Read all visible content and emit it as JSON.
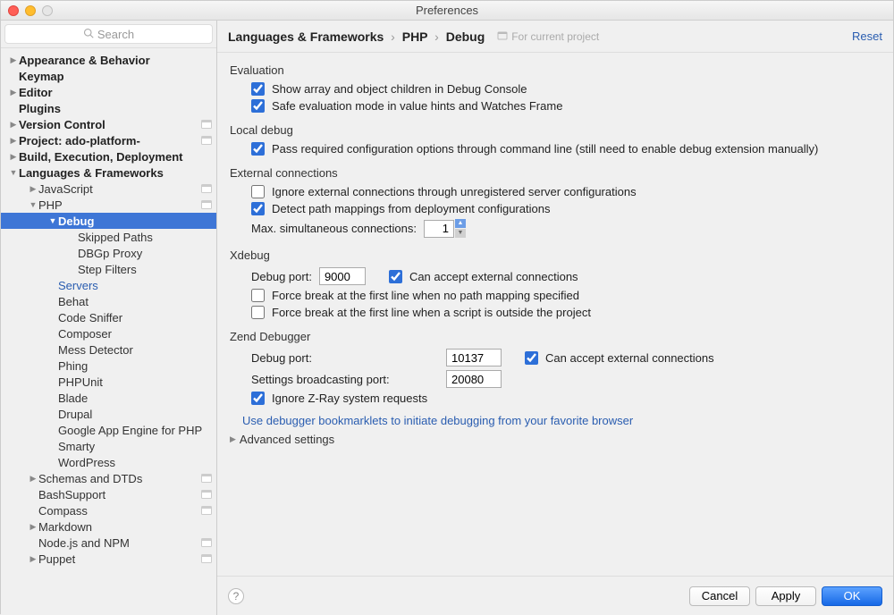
{
  "window": {
    "title": "Preferences"
  },
  "sidebar": {
    "search_placeholder": "Search",
    "items": [
      {
        "label": "Appearance & Behavior",
        "bold": true,
        "arrow": "right",
        "depth": 1
      },
      {
        "label": "Keymap",
        "bold": true,
        "depth": 1
      },
      {
        "label": "Editor",
        "bold": true,
        "arrow": "right",
        "depth": 1
      },
      {
        "label": "Plugins",
        "bold": true,
        "depth": 1
      },
      {
        "label": "Version Control",
        "bold": true,
        "arrow": "right",
        "depth": 1,
        "badge": true
      },
      {
        "label": "Project: ado-platform-",
        "bold": true,
        "arrow": "right",
        "depth": 1,
        "badge": true
      },
      {
        "label": "Build, Execution, Deployment",
        "bold": true,
        "arrow": "right",
        "depth": 1
      },
      {
        "label": "Languages & Frameworks",
        "bold": true,
        "arrow": "down",
        "depth": 1
      },
      {
        "label": "JavaScript",
        "arrow": "right",
        "depth": 2,
        "badge": true
      },
      {
        "label": "PHP",
        "arrow": "down",
        "depth": 2,
        "badge": true
      },
      {
        "label": "Debug",
        "arrow": "down",
        "depth": 3,
        "selected": true
      },
      {
        "label": "Skipped Paths",
        "depth": 4
      },
      {
        "label": "DBGp Proxy",
        "depth": 4
      },
      {
        "label": "Step Filters",
        "depth": 4
      },
      {
        "label": "Servers",
        "depth": 3,
        "link": true
      },
      {
        "label": "Behat",
        "depth": 3
      },
      {
        "label": "Code Sniffer",
        "depth": 3
      },
      {
        "label": "Composer",
        "depth": 3
      },
      {
        "label": "Mess Detector",
        "depth": 3
      },
      {
        "label": "Phing",
        "depth": 3
      },
      {
        "label": "PHPUnit",
        "depth": 3
      },
      {
        "label": "Blade",
        "depth": 3
      },
      {
        "label": "Drupal",
        "depth": 3
      },
      {
        "label": "Google App Engine for PHP",
        "depth": 3
      },
      {
        "label": "Smarty",
        "depth": 3
      },
      {
        "label": "WordPress",
        "depth": 3
      },
      {
        "label": "Schemas and DTDs",
        "arrow": "right",
        "depth": 2,
        "badge": true
      },
      {
        "label": "BashSupport",
        "depth": 2,
        "badge": true
      },
      {
        "label": "Compass",
        "depth": 2,
        "badge": true
      },
      {
        "label": "Markdown",
        "arrow": "right",
        "depth": 2
      },
      {
        "label": "Node.js and NPM",
        "depth": 2,
        "badge": true
      },
      {
        "label": "Puppet",
        "arrow": "right",
        "depth": 2,
        "badge": true
      }
    ]
  },
  "header": {
    "crumb1": "Languages & Frameworks",
    "crumb2": "PHP",
    "crumb3": "Debug",
    "project_scope": "For current project",
    "reset": "Reset"
  },
  "sections": {
    "evaluation": {
      "title": "Evaluation",
      "opt1": "Show array and object children in Debug Console",
      "opt2": "Safe evaluation mode in value hints and Watches Frame"
    },
    "local_debug": {
      "title": "Local debug",
      "opt1": "Pass required configuration options through command line (still need to enable debug extension manually)"
    },
    "external": {
      "title": "External connections",
      "opt1": "Ignore external connections through unregistered server configurations",
      "opt2": "Detect path mappings from deployment configurations",
      "max_label": "Max. simultaneous connections:",
      "max_value": "1"
    },
    "xdebug": {
      "title": "Xdebug",
      "port_label": "Debug port:",
      "port_value": "9000",
      "can_accept": "Can accept external connections",
      "force1": "Force break at the first line when no path mapping specified",
      "force2": "Force break at the first line when a script is outside the project"
    },
    "zend": {
      "title": "Zend Debugger",
      "port_label": "Debug port:",
      "port_value": "10137",
      "can_accept": "Can accept external connections",
      "broadcast_label": "Settings broadcasting port:",
      "broadcast_value": "20080",
      "ignore_zray": "Ignore Z-Ray system requests"
    },
    "bookmarklets_link": "Use debugger bookmarklets to initiate debugging from your favorite browser",
    "advanced": "Advanced settings"
  },
  "footer": {
    "cancel": "Cancel",
    "apply": "Apply",
    "ok": "OK"
  }
}
